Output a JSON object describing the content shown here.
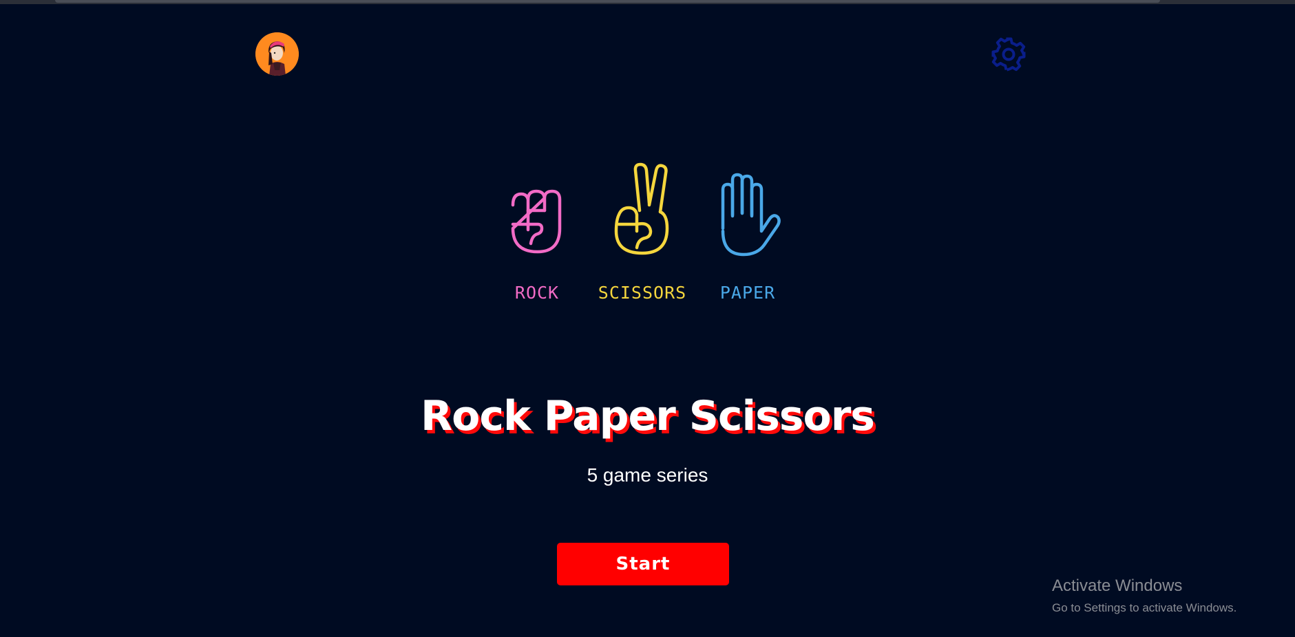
{
  "header": {
    "avatar_icon": "user-avatar-icon",
    "settings_icon": "gear-icon"
  },
  "choices": [
    {
      "label": "ROCK",
      "icon": "fist-icon",
      "color": "#f26bc6"
    },
    {
      "label": "SCISSORS",
      "icon": "victory-hand-icon",
      "color": "#f5d63d"
    },
    {
      "label": "PAPER",
      "icon": "open-hand-icon",
      "color": "#4aa8e8"
    }
  ],
  "main": {
    "title": "Rock Paper Scissors",
    "subtitle": "5 game series",
    "start_label": "Start"
  },
  "watermark": {
    "title": "Activate Windows",
    "subtitle": "Go to Settings to activate Windows."
  },
  "colors": {
    "background": "#000b22",
    "accent": "#ff0000",
    "title_shadow": "#ff0a0a",
    "settings": "#0a1e8a"
  }
}
